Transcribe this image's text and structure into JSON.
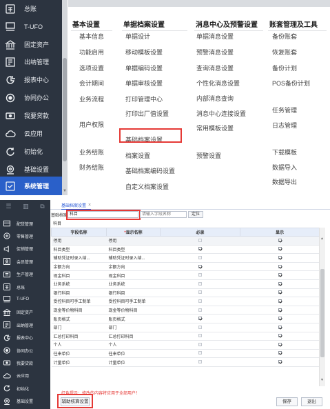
{
  "top": {
    "sidebar": [
      {
        "label": "总账",
        "icon": "ledger-icon"
      },
      {
        "label": "T-UFO",
        "icon": "ufo-icon"
      },
      {
        "label": "固定资产",
        "icon": "bank-icon"
      },
      {
        "label": "出纳管理",
        "icon": "cashier-icon"
      },
      {
        "label": "报表中心",
        "icon": "report-icon"
      },
      {
        "label": "协同办公",
        "icon": "collab-icon"
      },
      {
        "label": "我要贷款",
        "icon": "loan-icon"
      },
      {
        "label": "云应用",
        "icon": "cloud-icon"
      },
      {
        "label": "初始化",
        "icon": "init-icon"
      },
      {
        "label": "基础设置",
        "icon": "settings-icon"
      },
      {
        "label": "系统管理",
        "icon": "system-icon"
      }
    ],
    "columns": [
      {
        "title": "基本设置",
        "items": [
          "基本信息",
          "功能启用",
          "选项设置",
          "会计期间",
          "业务流程",
          "用户权限",
          "业务结账",
          "财务结账"
        ]
      },
      {
        "title": "单据档案设置",
        "items": [
          "单据设计",
          "移动模板设置",
          "单据编码设置",
          "单据审核设置",
          "打印管理中心",
          "打印出厂值设置",
          "基础档案设置",
          "档案设置",
          "基础档案编码设置",
          "自定义档案设置"
        ]
      },
      {
        "title": "消息中心及预警设置",
        "items": [
          "单据消息设置",
          "预警消息设置",
          "查询消息设置",
          "个性化消息设置",
          "内部消息查询",
          "消息中心连接设置",
          "常用模板设置",
          "预警设置"
        ]
      },
      {
        "title": "账套管理及工具",
        "items": [
          "备份账套",
          "恢复账套",
          "备份计划",
          "POS备份计划",
          "任务管理",
          "日志管理",
          "下载模板",
          "数据导入",
          "数据导出"
        ]
      }
    ]
  },
  "bottom": {
    "sidebar_top": [
      "☰",
      "▥",
      "⧉"
    ],
    "sidebar": [
      {
        "label": "配货管理",
        "icon": "distribution-icon"
      },
      {
        "label": "零售管理",
        "icon": "retail-icon"
      },
      {
        "label": "促销管理",
        "icon": "promo-icon"
      },
      {
        "label": "会员管理",
        "icon": "member-icon"
      },
      {
        "label": "生产管理",
        "icon": "production-icon"
      },
      {
        "label": "总账",
        "icon": "ledger-icon"
      },
      {
        "label": "T-UFO",
        "icon": "ufo-icon"
      },
      {
        "label": "固定资产",
        "icon": "bank-icon"
      },
      {
        "label": "出纳管理",
        "icon": "cashier-icon"
      },
      {
        "label": "报表中心",
        "icon": "report-icon"
      },
      {
        "label": "协同办公",
        "icon": "collab-icon"
      },
      {
        "label": "我要贷款",
        "icon": "loan-icon"
      },
      {
        "label": "云应用",
        "icon": "cloud-icon"
      },
      {
        "label": "初始化",
        "icon": "init-icon"
      },
      {
        "label": "基础设置",
        "icon": "settings-icon"
      }
    ],
    "tab_label": "基础档案设置",
    "filter": {
      "label": "基础档案",
      "value": "科目",
      "placeholder": "请输入字段名称",
      "locate_button": "定位",
      "sub_label": "科目"
    },
    "table": {
      "headers": [
        "字段名称",
        "显示名称",
        "必录",
        "显示"
      ],
      "rows": [
        {
          "field": "停用",
          "display": "停用",
          "required": false,
          "show": true
        },
        {
          "field": "科目类型",
          "display": "科目类型",
          "required": true,
          "show": true
        },
        {
          "field": "辅助凭证时录入结...",
          "display": "辅助凭证时录入结...",
          "required": false,
          "show": true
        },
        {
          "field": "余额方向",
          "display": "余额方向",
          "required": true,
          "show": true
        },
        {
          "field": "现金科目",
          "display": "现金科目",
          "required": false,
          "show": true
        },
        {
          "field": "业务系统",
          "display": "业务系统",
          "required": false,
          "show": true
        },
        {
          "field": "银行科目",
          "display": "银行科目",
          "required": false,
          "show": true
        },
        {
          "field": "受控科目可手工制单",
          "display": "受控科目可手工制单",
          "required": false,
          "show": true
        },
        {
          "field": "现金等价物科目",
          "display": "现金等价物科目",
          "required": false,
          "show": true
        },
        {
          "field": "账页格式",
          "display": "账页格式",
          "required": true,
          "show": true
        },
        {
          "field": "部门",
          "display": "部门",
          "required": false,
          "show": true
        },
        {
          "field": "汇总打印科目",
          "display": "汇总打印科目",
          "required": false,
          "show": true
        },
        {
          "field": "个人",
          "display": "个人",
          "required": false,
          "show": true
        },
        {
          "field": "往来单位",
          "display": "往来单位",
          "required": false,
          "show": true
        },
        {
          "field": "计量单位",
          "display": "计量单位",
          "required": false,
          "show": true
        }
      ]
    },
    "note": "红色提示：修改的内容将应用于全部用户！",
    "aux_button": "辅助核算设置",
    "save_button": "保存",
    "exit_button": "退出"
  }
}
